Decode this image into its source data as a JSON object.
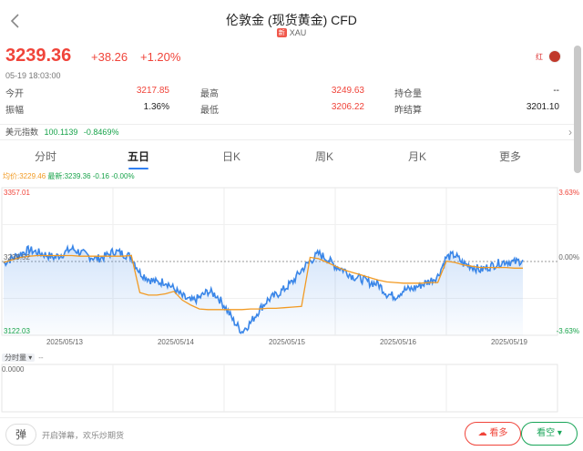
{
  "header": {
    "back_icon": "chevron-left-icon",
    "title": "伦敦金 (现货黄金) CFD",
    "tag": "新",
    "code": "XAU"
  },
  "quote": {
    "price": "3239.36",
    "change": "+38.26",
    "change_pct": "+1.20%",
    "timestamp": "05-19 18:03:00",
    "avatar_text": "红"
  },
  "stats": [
    {
      "label": "今开",
      "value": "3217.85",
      "color": "red"
    },
    {
      "label": "最高",
      "value": "3249.63",
      "color": "red"
    },
    {
      "label": "持仓量",
      "value": "--",
      "color": "dark"
    },
    {
      "label": "振幅",
      "value": "1.36%",
      "color": "dark"
    },
    {
      "label": "最低",
      "value": "3206.22",
      "color": "red"
    },
    {
      "label": "昨结算",
      "value": "3201.10",
      "color": "dark"
    }
  ],
  "index": {
    "label": "美元指数",
    "value": "100.1139",
    "change": "-0.8469%"
  },
  "tabs": [
    {
      "label": "分时"
    },
    {
      "label": "五日"
    },
    {
      "label": "日K"
    },
    {
      "label": "周K"
    },
    {
      "label": "月K"
    },
    {
      "label": "更多"
    }
  ],
  "active_tab": "五日",
  "legend": {
    "avg": "均价:3229.46",
    "latest": "最新:3239.36",
    "change": "-0.16",
    "pct": "-0.00%"
  },
  "chart_data": {
    "type": "line",
    "x_labels": [
      "2025/05/13",
      "2025/05/14",
      "2025/05/15",
      "2025/05/16",
      "2025/05/19"
    ],
    "ylim": [
      3122.03,
      3357.01
    ],
    "y_tick_labels": [
      "3357.01",
      "3239.52",
      "3122.03"
    ],
    "pct_tick_labels": [
      "3.63%",
      "0.00%",
      "-3.63%"
    ],
    "reference_value": 3239.52,
    "grid": true,
    "series": [
      {
        "color": "#3a86e8",
        "values": [
          3237,
          3245,
          3252,
          3258,
          3254,
          3250,
          3246,
          3252,
          3260,
          3254,
          3248,
          3244,
          3248,
          3256,
          3252,
          3247,
          3222,
          3212,
          3206,
          3208,
          3196,
          3184,
          3176,
          3182,
          3192,
          3186,
          3168,
          3145,
          3128,
          3142,
          3162,
          3178,
          3186,
          3196,
          3208,
          3226,
          3240,
          3252,
          3244,
          3232,
          3226,
          3216,
          3212,
          3206,
          3204,
          3188,
          3184,
          3194,
          3196,
          3202,
          3208,
          3216,
          3246,
          3250,
          3236,
          3232,
          3226,
          3231,
          3236,
          3240,
          3238,
          3242
        ]
      },
      {
        "color": "#f29a22",
        "values": [
          3238,
          3242,
          3246,
          3248,
          3249,
          3249,
          3249,
          3249,
          3249,
          3248,
          3248,
          3248,
          3248,
          3248,
          3248,
          3249,
          3190,
          3186,
          3186,
          3188,
          3192,
          3178,
          3170,
          3164,
          3163,
          3163,
          3163,
          3163,
          3163,
          3164,
          3164,
          3165,
          3165,
          3166,
          3167,
          3168,
          3246,
          3244,
          3238,
          3232,
          3226,
          3222,
          3218,
          3214,
          3210,
          3207,
          3206,
          3205,
          3205,
          3205,
          3206,
          3206,
          3240,
          3238,
          3234,
          3232,
          3230,
          3230,
          3230,
          3230,
          3229,
          3229
        ]
      }
    ]
  },
  "volume": {
    "label": "分时量",
    "dash": "--",
    "zero": "0.0000"
  },
  "bottom": {
    "danmu_icon": "弹",
    "danmu_text": "开启弹幕，欢乐炒期货",
    "bear_label": "看多",
    "bull_label": "看空"
  }
}
